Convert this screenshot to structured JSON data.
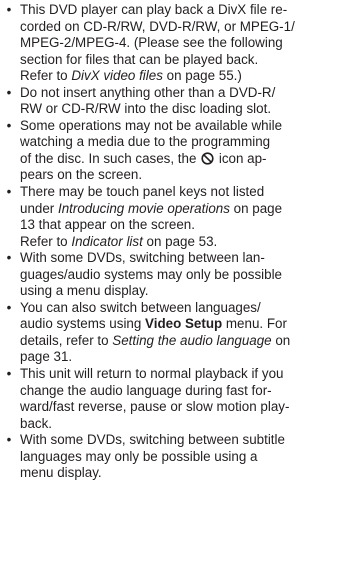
{
  "bullet_char": "•",
  "items": [
    {
      "lines": [
        [
          {
            "t": "This DVD player can play back a DivX file re-"
          }
        ],
        [
          {
            "t": "corded on CD-R/RW, DVD-R/RW, or MPEG-1/"
          }
        ],
        [
          {
            "t": "MPEG-2/MPEG-4. (Please see the following"
          }
        ],
        [
          {
            "t": "section for files that can be played back."
          }
        ],
        [
          {
            "t": "Refer to "
          },
          {
            "t": "DivX video files",
            "s": "it"
          },
          {
            "t": " on page 55.)"
          }
        ]
      ]
    },
    {
      "lines": [
        [
          {
            "t": "Do not insert anything other than a DVD-R/"
          }
        ],
        [
          {
            "t": "RW or CD-R/RW into the disc loading slot."
          }
        ]
      ]
    },
    {
      "lines": [
        [
          {
            "t": "Some operations may not be available while"
          }
        ],
        [
          {
            "t": "watching a media due to the programming"
          }
        ],
        [
          {
            "t": "of the disc. In such cases, the "
          },
          {
            "icon": "prohibit-icon"
          },
          {
            "t": " icon ap-"
          }
        ],
        [
          {
            "t": "pears on the screen."
          }
        ]
      ]
    },
    {
      "lines": [
        [
          {
            "t": "There may be touch panel keys not listed"
          }
        ],
        [
          {
            "t": "under "
          },
          {
            "t": "Introducing movie operations",
            "s": "it"
          },
          {
            "t": " on page"
          }
        ],
        [
          {
            "t": "13 that appear on the screen."
          }
        ],
        [
          {
            "t": "Refer to "
          },
          {
            "t": "Indicator list",
            "s": "it"
          },
          {
            "t": " on page 53."
          }
        ]
      ]
    },
    {
      "lines": [
        [
          {
            "t": "With some DVDs, switching between lan-"
          }
        ],
        [
          {
            "t": "guages/audio systems may only be possible"
          }
        ],
        [
          {
            "t": "using a menu display."
          }
        ]
      ]
    },
    {
      "lines": [
        [
          {
            "t": "You can also switch between languages/"
          }
        ],
        [
          {
            "t": "audio systems using "
          },
          {
            "t": "Video Setup",
            "s": "bold"
          },
          {
            "t": " menu. For"
          }
        ],
        [
          {
            "t": "details, refer to "
          },
          {
            "t": "Setting the audio language",
            "s": "it"
          },
          {
            "t": " on"
          }
        ],
        [
          {
            "t": "page 31."
          }
        ]
      ]
    },
    {
      "lines": [
        [
          {
            "t": "This unit will return to normal playback if you"
          }
        ],
        [
          {
            "t": "change the audio language during fast for-"
          }
        ],
        [
          {
            "t": "ward/fast reverse, pause or slow motion play-"
          }
        ],
        [
          {
            "t": "back."
          }
        ]
      ]
    },
    {
      "lines": [
        [
          {
            "t": "With some DVDs, switching between subtitle"
          }
        ],
        [
          {
            "t": "languages may only be possible using a"
          }
        ],
        [
          {
            "t": "menu display."
          }
        ]
      ]
    }
  ]
}
